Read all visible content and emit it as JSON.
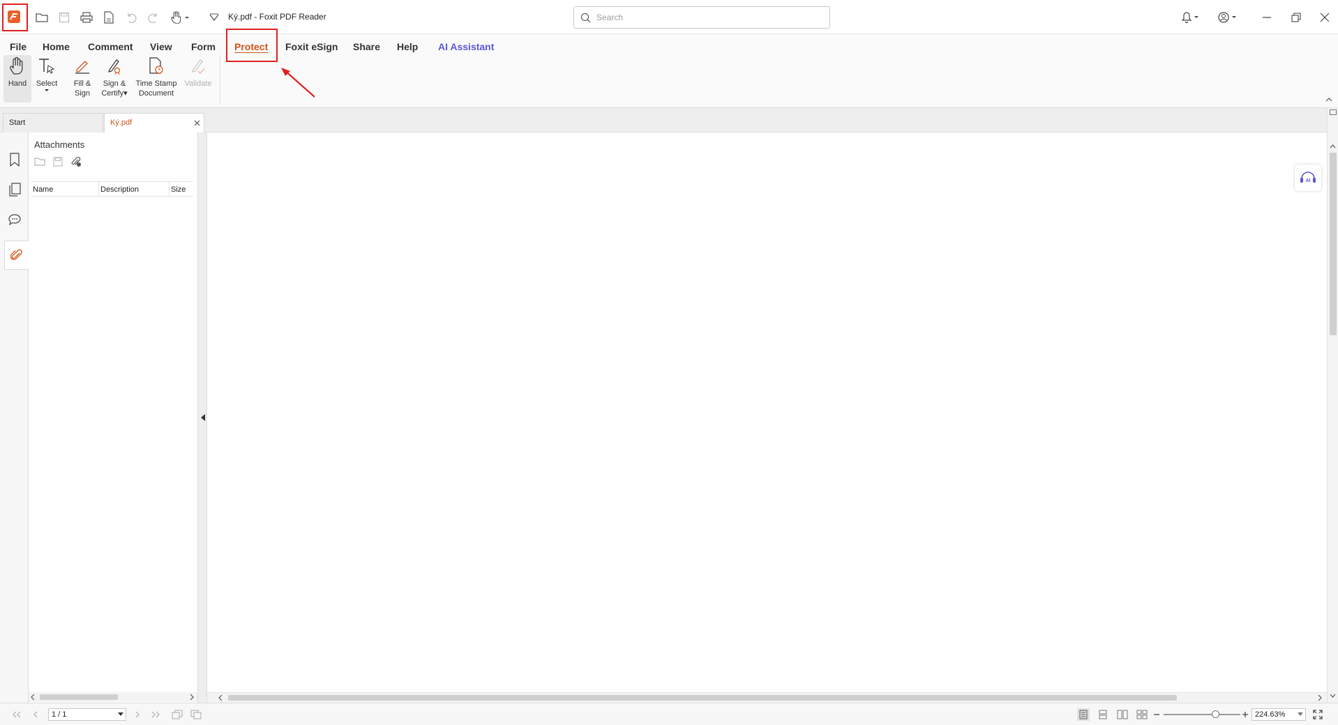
{
  "window": {
    "title": "Ký.pdf - Foxit PDF Reader",
    "search_placeholder": "Search"
  },
  "menu_tabs": [
    {
      "label": "File"
    },
    {
      "label": "Home"
    },
    {
      "label": "Comment"
    },
    {
      "label": "View"
    },
    {
      "label": "Form"
    },
    {
      "label": "Protect",
      "active": true
    },
    {
      "label": "Foxit eSign"
    },
    {
      "label": "Share"
    },
    {
      "label": "Help"
    },
    {
      "label": "AI Assistant"
    }
  ],
  "ribbon_tools": {
    "hand": "Hand",
    "select": "Select",
    "fill_sign_1": "Fill &",
    "fill_sign_2": "Sign",
    "sign_certify_1": "Sign &",
    "sign_certify_2": "Certify",
    "time_stamp_1": "Time Stamp",
    "time_stamp_2": "Document",
    "validate": "Validate"
  },
  "doc_tabs": [
    {
      "label": "Start"
    },
    {
      "label": "Ký.pdf",
      "active": true
    }
  ],
  "attachments_panel": {
    "title": "Attachments",
    "columns": [
      "Name",
      "Description",
      "Size"
    ]
  },
  "status_bar": {
    "page_value": "1 / 1",
    "zoom_value": "224.63%",
    "zoom_level": 0.68
  },
  "colors": {
    "accent": "#d0541a",
    "ai_accent": "#5b56d8",
    "annotation_red": "#e0201d"
  }
}
